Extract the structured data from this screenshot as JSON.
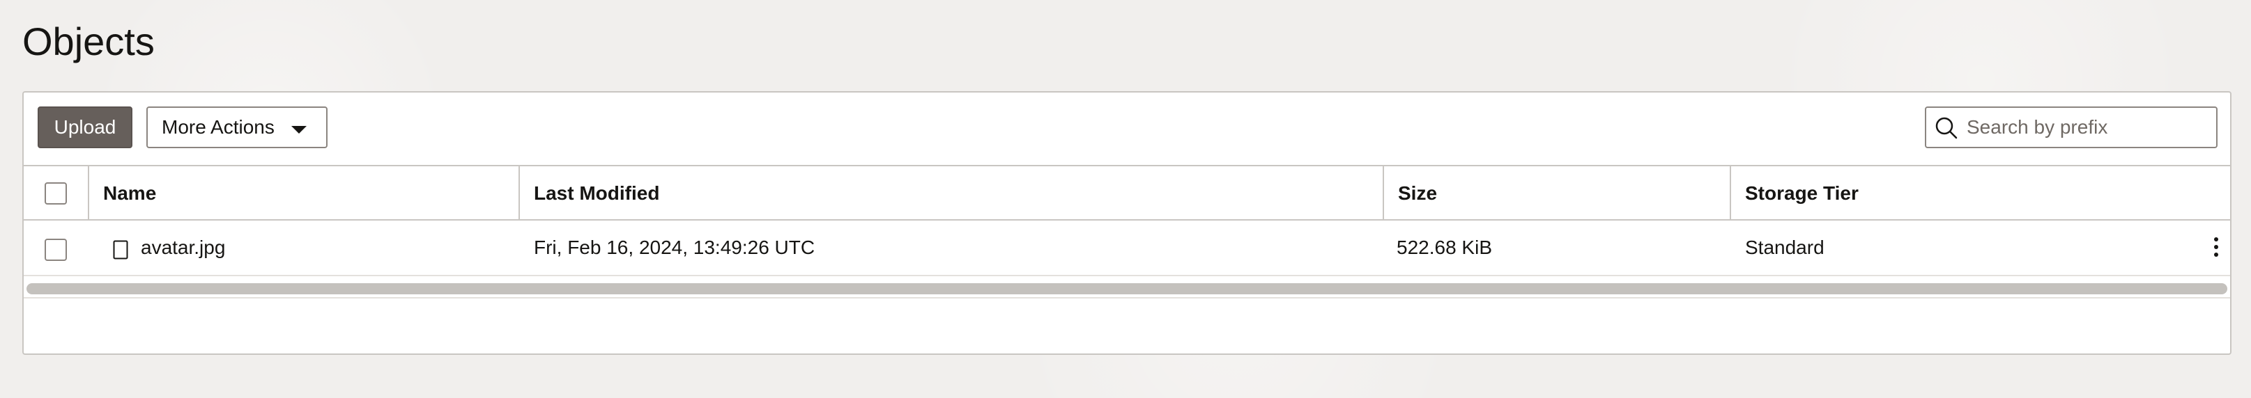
{
  "page": {
    "title": "Objects"
  },
  "toolbar": {
    "upload_label": "Upload",
    "more_actions_label": "More Actions",
    "search": {
      "placeholder": "Search by prefix",
      "value": ""
    }
  },
  "table": {
    "columns": [
      "Name",
      "Last Modified",
      "Size",
      "Storage Tier"
    ],
    "rows": [
      {
        "name": "avatar.jpg",
        "last_modified": "Fri, Feb 16, 2024, 13:49:26 UTC",
        "size": "522.68 KiB",
        "storage_tier": "Standard",
        "icon": "file-icon",
        "selected": false
      }
    ]
  },
  "colors": {
    "primary_button": "#665f5b",
    "background": "#f1efed",
    "border": "#c9c6c2"
  }
}
